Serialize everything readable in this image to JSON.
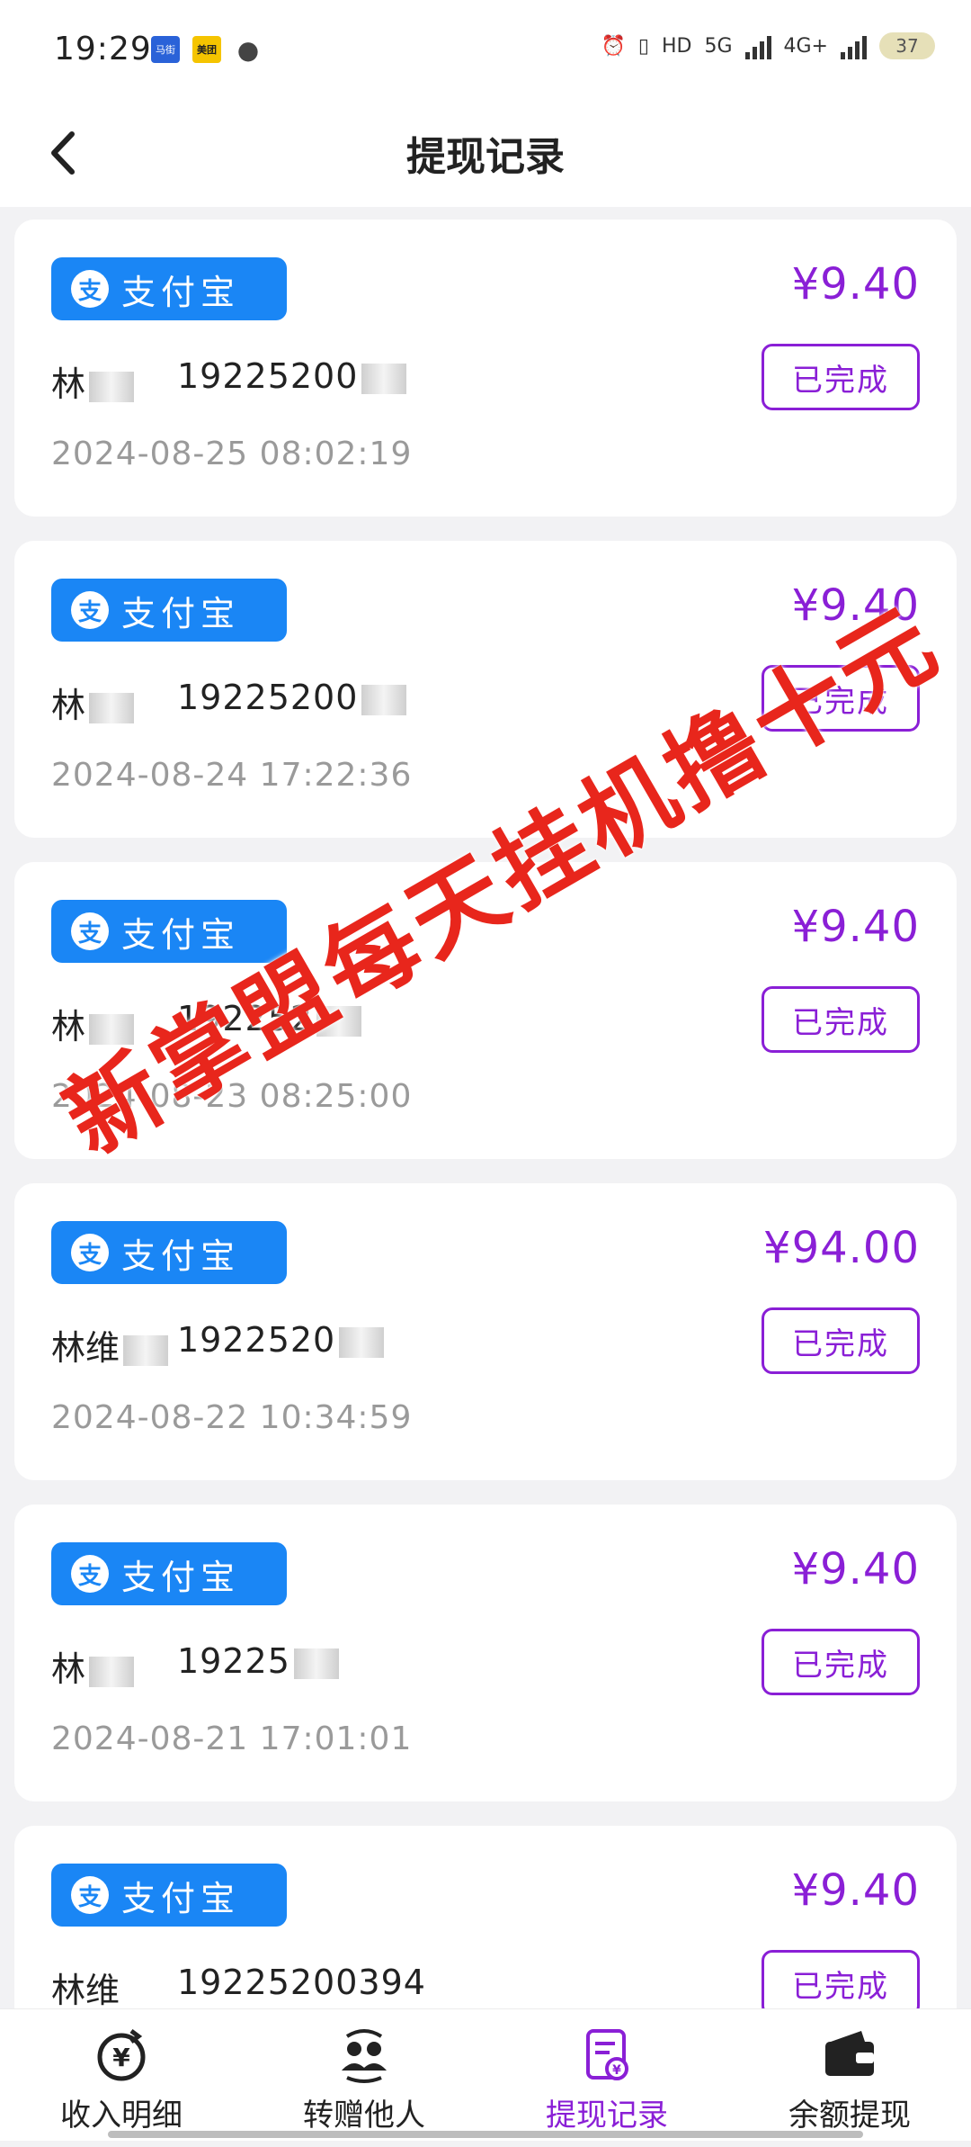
{
  "status_bar": {
    "time": "19:29",
    "app_badges": [
      "马街",
      "美团"
    ],
    "network": [
      "HD",
      "5G",
      "4G+"
    ],
    "battery": "37"
  },
  "header": {
    "title": "提现记录",
    "back_icon": "chevron-left-icon"
  },
  "records": [
    {
      "method": "支付宝",
      "amount": "¥9.40",
      "name": "林",
      "account": "19225200",
      "status": "已完成",
      "time": "2024-08-25 08:02:19"
    },
    {
      "method": "支付宝",
      "amount": "¥9.40",
      "name": "林",
      "account": "19225200",
      "status": "已完成",
      "time": "2024-08-24 17:22:36"
    },
    {
      "method": "支付宝",
      "amount": "¥9.40",
      "name": "林",
      "account": "192252",
      "status": "已完成",
      "time": "2024-08-23 08:25:00"
    },
    {
      "method": "支付宝",
      "amount": "¥94.00",
      "name": "林维",
      "account": "1922520",
      "status": "已完成",
      "time": "2024-08-22 10:34:59"
    },
    {
      "method": "支付宝",
      "amount": "¥9.40",
      "name": "林",
      "account": "19225",
      "status": "已完成",
      "time": "2024-08-21 17:01:01"
    },
    {
      "method": "支付宝",
      "amount": "¥9.40",
      "name": "林维",
      "account": "19225200394",
      "status": "已完成",
      "time": ""
    }
  ],
  "alipay_icon_glyph": "支",
  "watermark": "新掌盟每天挂机撸十元",
  "tabs": [
    {
      "label": "收入明细",
      "icon": "yuan-refresh-icon",
      "active": false
    },
    {
      "label": "转赠他人",
      "icon": "users-transfer-icon",
      "active": false
    },
    {
      "label": "提现记录",
      "icon": "document-yuan-icon",
      "active": true
    },
    {
      "label": "余额提现",
      "icon": "wallet-icon",
      "active": false
    }
  ],
  "colors": {
    "accent": "#8a1fd6",
    "alipay": "#1a86f5",
    "watermark": "#e8261c"
  }
}
